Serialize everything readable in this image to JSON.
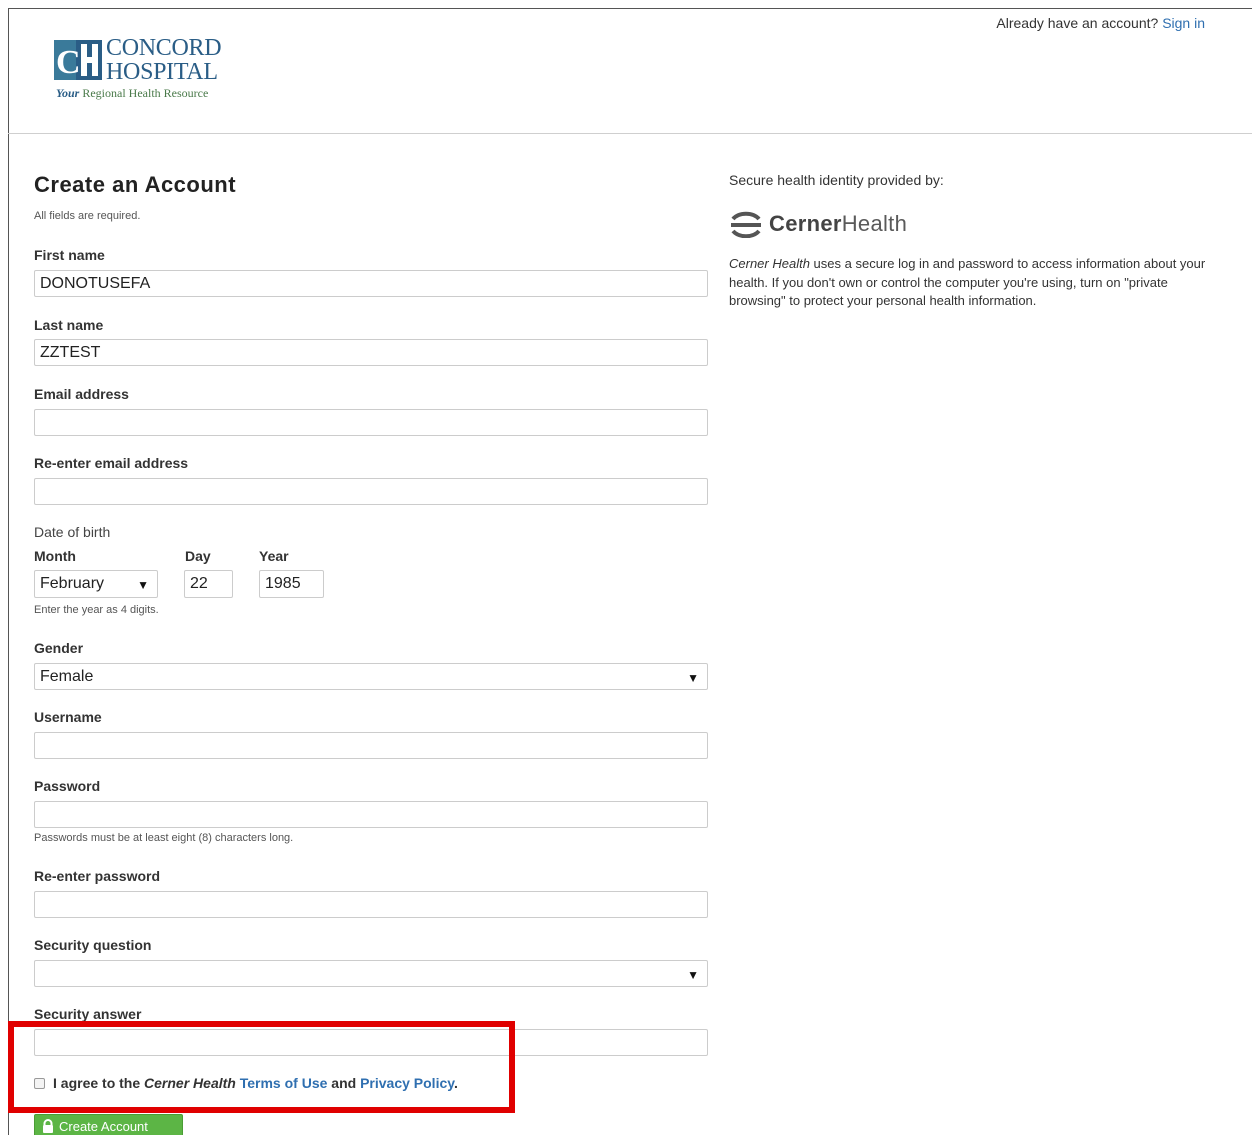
{
  "header": {
    "logo_line1": "CONCORD",
    "logo_line2": "HOSPITAL",
    "tagline_your": "Your",
    "tagline_rest": " Regional Health Resource",
    "signin_prompt": "Already have an account?",
    "signin_link": "Sign in"
  },
  "form": {
    "title": "Create an Account",
    "required_note": "All fields are required.",
    "first_name_label": "First name",
    "first_name_value": "DONOTUSEFA",
    "last_name_label": "Last name",
    "last_name_value": "ZZTEST",
    "email_label": "Email address",
    "email_value": "",
    "reemail_label": "Re-enter email address",
    "reemail_value": "",
    "dob_label": "Date of birth",
    "month_label": "Month",
    "day_label": "Day",
    "year_label": "Year",
    "month_value": "February",
    "day_value": "22",
    "year_value": "1985",
    "year_hint": "Enter the year as 4 digits.",
    "gender_label": "Gender",
    "gender_value": "Female",
    "username_label": "Username",
    "username_value": "",
    "password_label": "Password",
    "password_value": "",
    "password_hint": "Passwords must be at least eight (8) characters long.",
    "repassword_label": "Re-enter password",
    "repassword_value": "",
    "security_question_label": "Security question",
    "security_question_value": "",
    "security_answer_label": "Security answer",
    "security_answer_value": "",
    "agree_prefix": "I agree to the ",
    "agree_brand": "Cerner Health",
    "agree_terms": "Terms of Use",
    "agree_and": " and ",
    "agree_privacy": "Privacy Policy",
    "agree_end": ".",
    "create_button": "Create Account"
  },
  "aside": {
    "lead": "Secure health identity provided by:",
    "wordmark_bold": "Cerner",
    "wordmark_rest": "Health",
    "desc_brand": "Cerner Health",
    "desc_text": " uses a secure log in and password to access information about your health. If you don't own or control the computer you're using, turn on \"private browsing\" to protect your personal health information."
  },
  "colors": {
    "link": "#2f6fb0",
    "button_green": "#5cb545",
    "highlight_red": "#e00000",
    "logo_blue": "#2a5d86"
  }
}
